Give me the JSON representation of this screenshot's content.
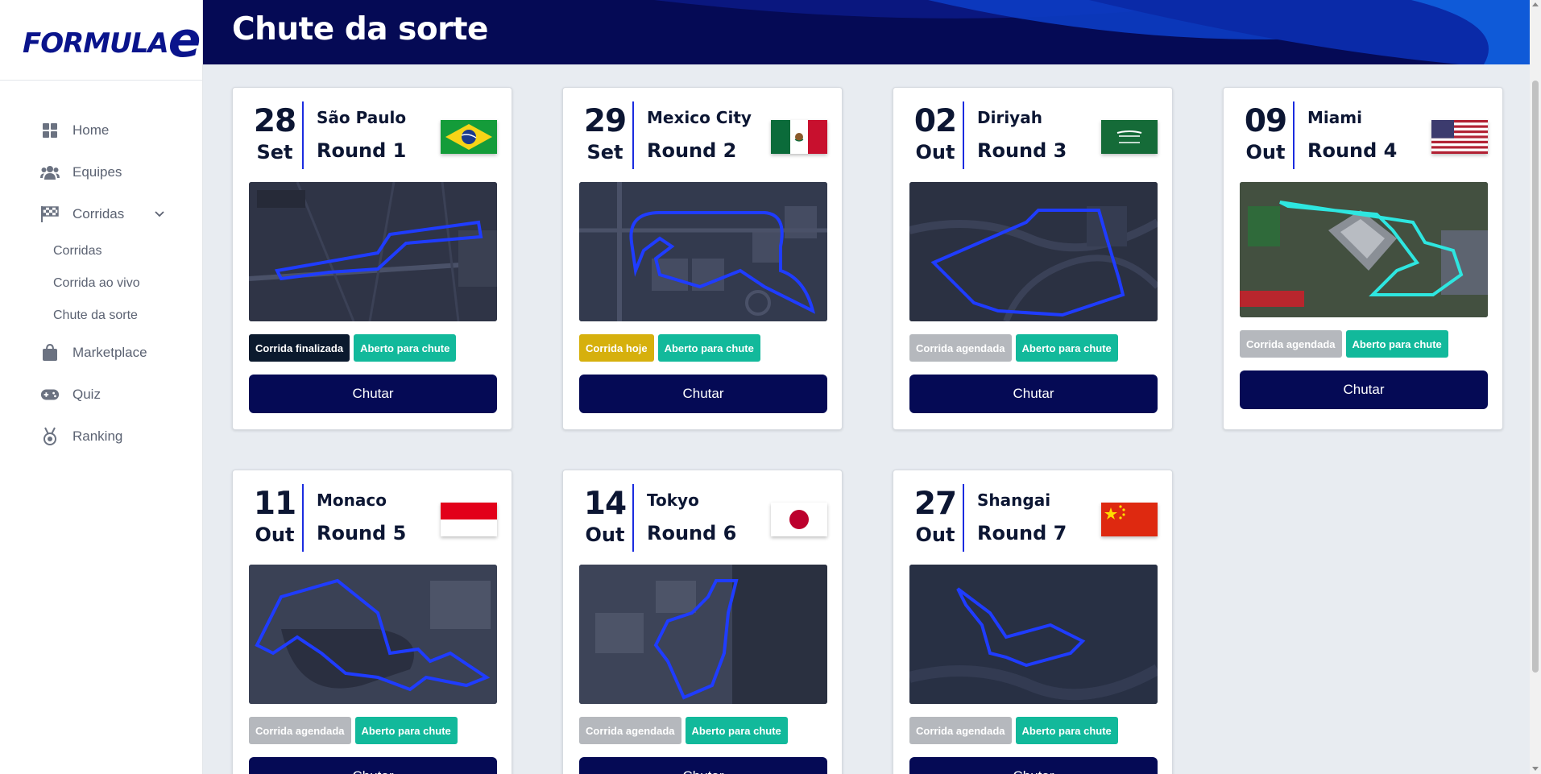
{
  "brand": {
    "logo_text": "FORMULA",
    "logo_e": "e"
  },
  "page": {
    "title": "Chute da sorte"
  },
  "sidebar": {
    "items": [
      {
        "label": "Home",
        "icon": "grid-icon"
      },
      {
        "label": "Equipes",
        "icon": "users-icon"
      },
      {
        "label": "Corridas",
        "icon": "checkered-flag-icon"
      },
      {
        "label": "Marketplace",
        "icon": "shopping-bag-icon"
      },
      {
        "label": "Quiz",
        "icon": "gamepad-icon"
      },
      {
        "label": "Ranking",
        "icon": "medal-icon"
      }
    ],
    "sub_items": [
      {
        "label": "Corridas"
      },
      {
        "label": "Corrida ao vivo"
      },
      {
        "label": "Chute da sorte"
      }
    ]
  },
  "races": [
    {
      "day": "28",
      "month": "Set",
      "city": "São Paulo",
      "round": "Round 1",
      "flag": "brazil",
      "status": "Corrida finalizada",
      "open": "Aberto para chute",
      "button": "Chutar"
    },
    {
      "day": "29",
      "month": "Set",
      "city": "Mexico City",
      "round": "Round 2",
      "flag": "mexico",
      "status": "Corrida hoje",
      "open": "Aberto para chute",
      "button": "Chutar"
    },
    {
      "day": "02",
      "month": "Out",
      "city": "Diriyah",
      "round": "Round 3",
      "flag": "saudi-arabia",
      "status": "Corrida agendada",
      "open": "Aberto para chute",
      "button": "Chutar"
    },
    {
      "day": "09",
      "month": "Out",
      "city": "Miami",
      "round": "Round 4",
      "flag": "usa",
      "status": "Corrida agendada",
      "open": "Aberto para chute",
      "button": "Chutar"
    },
    {
      "day": "11",
      "month": "Out",
      "city": "Monaco",
      "round": "Round 5",
      "flag": "monaco",
      "status": "Corrida agendada",
      "open": "Aberto para chute",
      "button": "Chutar"
    },
    {
      "day": "14",
      "month": "Out",
      "city": "Tokyo",
      "round": "Round 6",
      "flag": "japan",
      "status": "Corrida agendada",
      "open": "Aberto para chute",
      "button": "Chutar"
    },
    {
      "day": "27",
      "month": "Out",
      "city": "Shangai",
      "round": "Round 7",
      "flag": "china",
      "status": "Corrida agendada",
      "open": "Aberto para chute",
      "button": "Chutar"
    }
  ],
  "colors": {
    "navy": "#050a55",
    "accent": "#1b2ce0",
    "open": "#12b99b",
    "today": "#d6b00d",
    "scheduled": "#b5b8bd",
    "done": "#0b1a2e"
  }
}
